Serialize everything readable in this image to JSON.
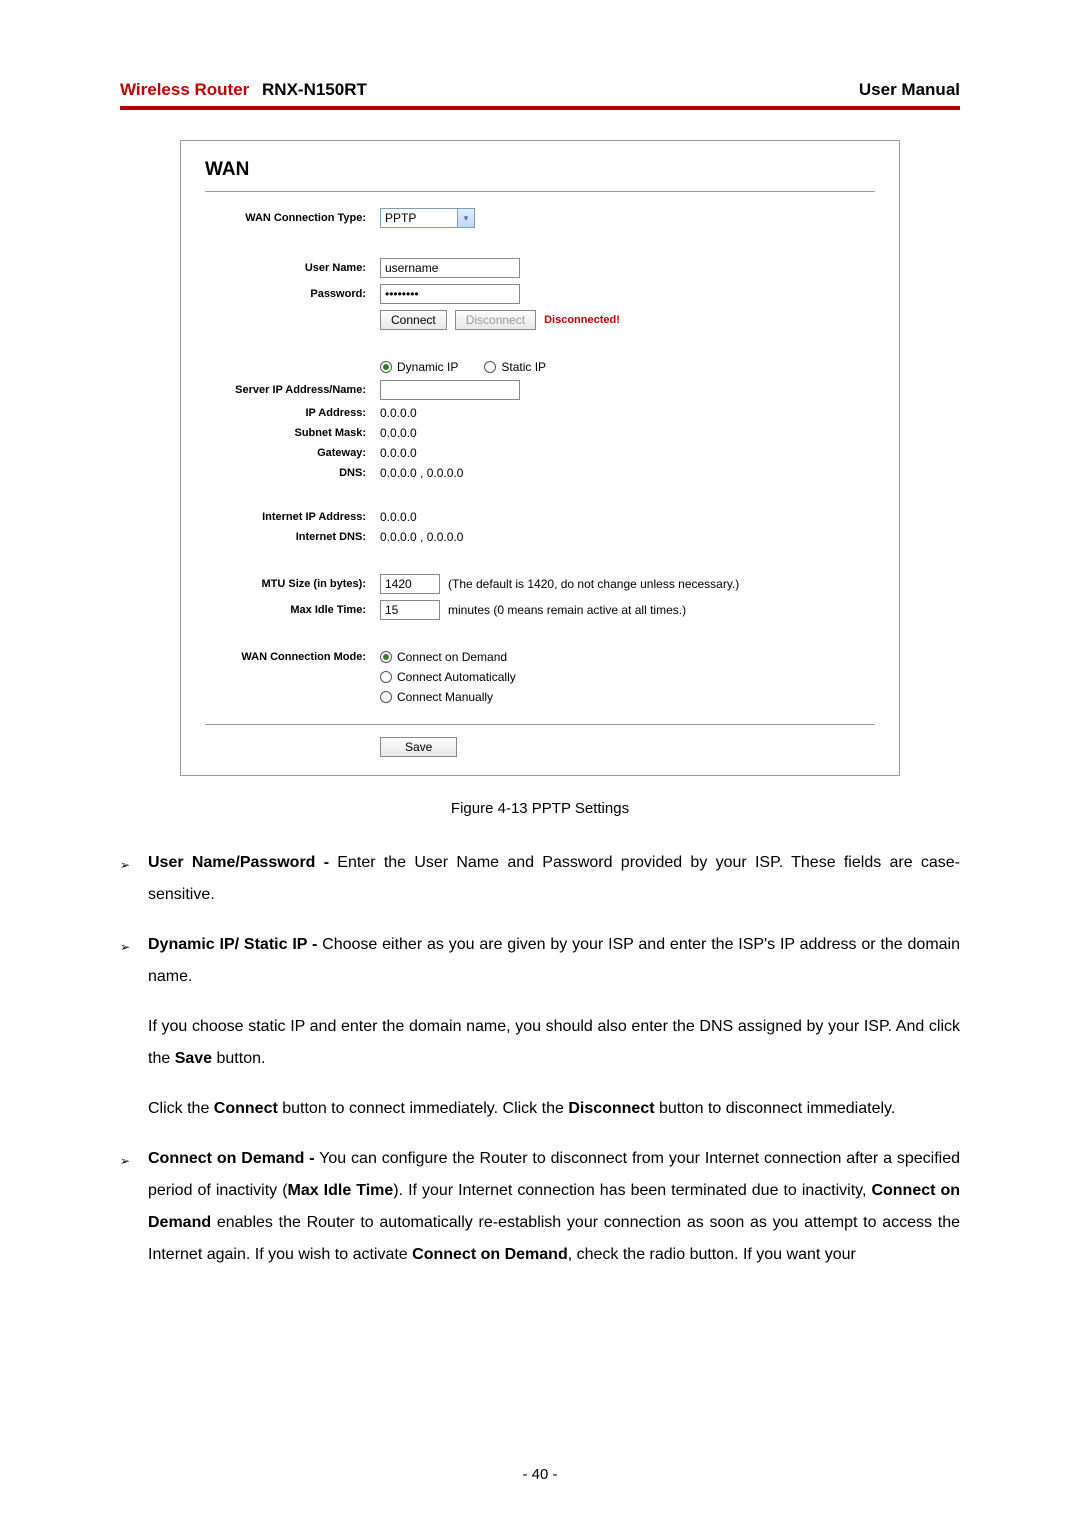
{
  "header": {
    "router_label": "Wireless Router",
    "model": "RNX-N150RT",
    "right": "User Manual"
  },
  "panel": {
    "title": "WAN",
    "wan_conn_type_label": "WAN Connection Type:",
    "wan_conn_type_value": "PPTP",
    "username_label": "User Name:",
    "username_value": "username",
    "password_label": "Password:",
    "password_value": "••••••••",
    "connect_btn": "Connect",
    "disconnect_btn": "Disconnect",
    "status": "Disconnected!",
    "ip_mode": {
      "dynamic": "Dynamic IP",
      "static": "Static IP"
    },
    "server_ip_label": "Server IP Address/Name:",
    "server_ip_value": "",
    "ip_address_label": "IP Address:",
    "ip_address_value": "0.0.0.0",
    "subnet_label": "Subnet Mask:",
    "subnet_value": "0.0.0.0",
    "gateway_label": "Gateway:",
    "gateway_value": "0.0.0.0",
    "dns_label": "DNS:",
    "dns_value": "0.0.0.0 , 0.0.0.0",
    "internet_ip_label": "Internet IP Address:",
    "internet_ip_value": "0.0.0.0",
    "internet_dns_label": "Internet DNS:",
    "internet_dns_value": "0.0.0.0 , 0.0.0.0",
    "mtu_label": "MTU Size (in bytes):",
    "mtu_value": "1420",
    "mtu_hint": "(The default is 1420, do not change unless necessary.)",
    "maxidle_label": "Max Idle Time:",
    "maxidle_value": "15",
    "maxidle_hint": "minutes (0 means remain active at all times.)",
    "conn_mode_label": "WAN Connection Mode:",
    "conn_mode": {
      "demand": "Connect on Demand",
      "auto": "Connect Automatically",
      "manual": "Connect Manually"
    },
    "save_btn": "Save"
  },
  "caption": "Figure 4-13    PPTP Settings",
  "bullets": {
    "b1_bold": "User Name/Password -",
    "b1_rest": " Enter the User Name and Password provided by your ISP. These fields are case-sensitive.",
    "b2_bold": "Dynamic IP/ Static IP -",
    "b2_rest": " Choose either as you are given by your ISP and enter the ISP's IP address or the domain name.",
    "p1_a": "If you choose static IP and enter the domain name, you should also enter the DNS assigned by your ISP. And click the ",
    "p1_b": "Save",
    "p1_c": " button.",
    "p2_a": "Click the ",
    "p2_b": "Connect",
    "p2_c": " button to connect immediately. Click the ",
    "p2_d": "Disconnect",
    "p2_e": " button to disconnect immediately.",
    "b3_bold": "Connect on Demand -",
    "b3_a": " You can configure the Router to disconnect from your Internet connection after a specified period of inactivity (",
    "b3_b": "Max Idle Time",
    "b3_c": "). If your Internet connection has been terminated due to inactivity, ",
    "b3_d": "Connect on Demand",
    "b3_e": " enables the Router to automatically re-establish your connection as soon as you attempt to access the Internet again. If you wish to activate ",
    "b3_f": "Connect on Demand",
    "b3_g": ", check the radio button. If you want your"
  },
  "pagenum": "- 40 -"
}
